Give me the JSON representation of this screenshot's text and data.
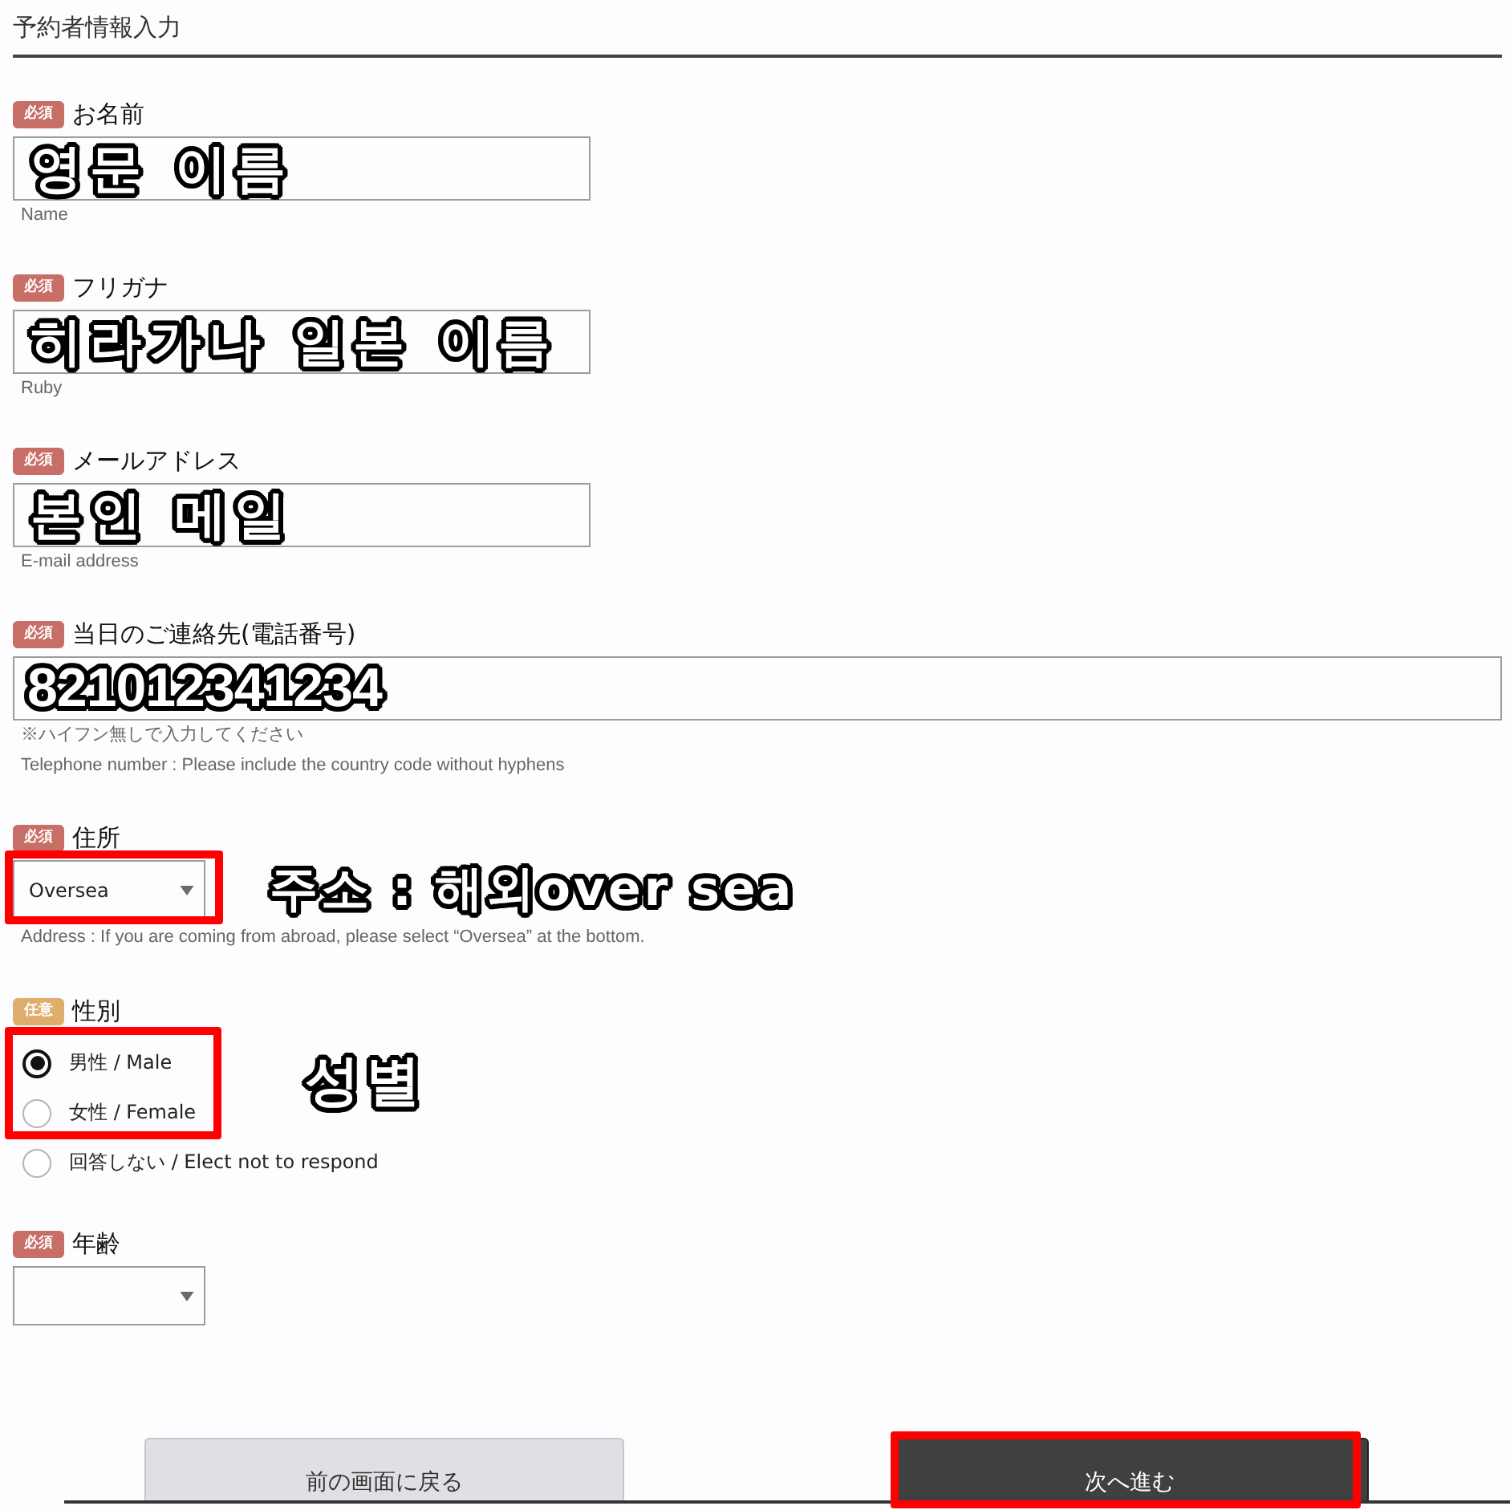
{
  "form": {
    "title": "予約者情報入力",
    "fields": [
      {
        "kind": "text",
        "badge": {
          "text": "必須",
          "kind": "required"
        },
        "label": "お名前",
        "annotation": "영문 이름",
        "hints": [
          "Name"
        ]
      },
      {
        "kind": "text",
        "badge": {
          "text": "必須",
          "kind": "required"
        },
        "label": "フリガナ",
        "annotation": "히라가나 일본 이름",
        "hints": [
          "Ruby"
        ]
      },
      {
        "kind": "text",
        "badge": {
          "text": "必須",
          "kind": "required"
        },
        "label": "メールアドレス",
        "annotation": "본인 메일",
        "hints": [
          "E-mail address"
        ]
      },
      {
        "kind": "tel",
        "badge": {
          "text": "必須",
          "kind": "required"
        },
        "label": "当日のご連絡先(電話番号)",
        "annotation": "821012341234",
        "hints": [
          "※ハイフン無しで入力してください",
          "Telephone number : Please include the country code without hyphens"
        ]
      },
      {
        "kind": "select",
        "badge": {
          "text": "必須",
          "kind": "required"
        },
        "label": "住所",
        "value": "Oversea",
        "highlighted": true,
        "annotation": "주소 : 해외over sea",
        "hints": [
          "Address : If you are coming from abroad, please select “Oversea” at the bottom."
        ]
      },
      {
        "kind": "radio",
        "badge": {
          "text": "任意",
          "kind": "optional"
        },
        "label": "性別",
        "annotation": "성별",
        "options": [
          {
            "label": "男性 / Male",
            "selected": true,
            "highlighted": true
          },
          {
            "label": "女性 / Female",
            "selected": false,
            "highlighted": true
          },
          {
            "label": "回答しない / Elect not to respond",
            "selected": false,
            "highlighted": false
          }
        ]
      },
      {
        "kind": "select",
        "badge": {
          "text": "必須",
          "kind": "required"
        },
        "label": "年齢"
      }
    ],
    "buttons": [
      {
        "label": "前の画面に戻る",
        "kind": "secondary",
        "highlighted": false
      },
      {
        "label": "次へ進む",
        "kind": "primary",
        "highlighted": true
      }
    ]
  }
}
